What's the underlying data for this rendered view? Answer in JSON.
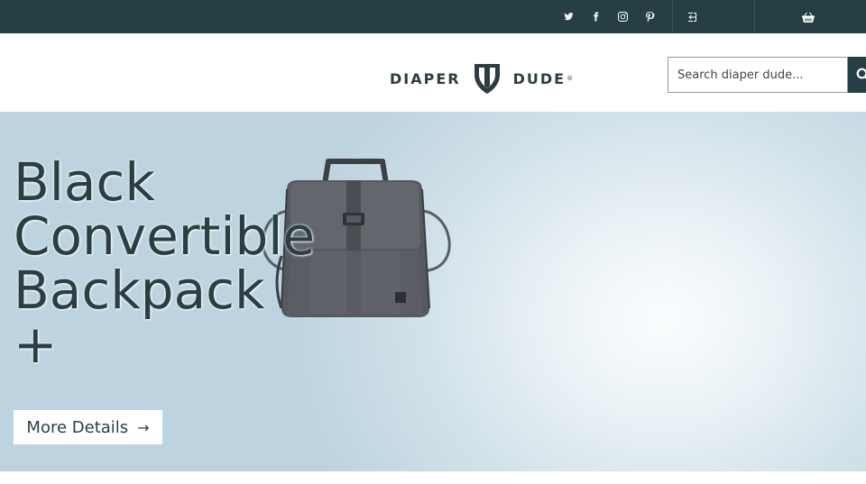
{
  "topbar": {
    "social": [
      {
        "icon": "twitter-icon",
        "label": "Twitter"
      },
      {
        "icon": "facebook-icon",
        "label": "Facebook"
      },
      {
        "icon": "instagram-icon",
        "label": "Instagram"
      },
      {
        "icon": "pinterest-icon",
        "label": "Pinterest"
      }
    ],
    "login_icon": "sign-in-icon",
    "cart_icon": "basket-icon"
  },
  "header": {
    "logo_left": "DIAPER",
    "logo_right": "DUDE",
    "logo_mark": "®",
    "search_placeholder": "Search diaper dude...",
    "search_icon": "search-icon"
  },
  "hero": {
    "title_lines": [
      "Black",
      "Convertible",
      "Backpack",
      "+"
    ],
    "button_label": "More Details",
    "button_arrow": "→"
  },
  "colors": {
    "topbar_bg": "#263f45",
    "text_dark": "#2a3f44",
    "hero_light": "#fbfdfe",
    "hero_edge": "#bdd3df"
  }
}
